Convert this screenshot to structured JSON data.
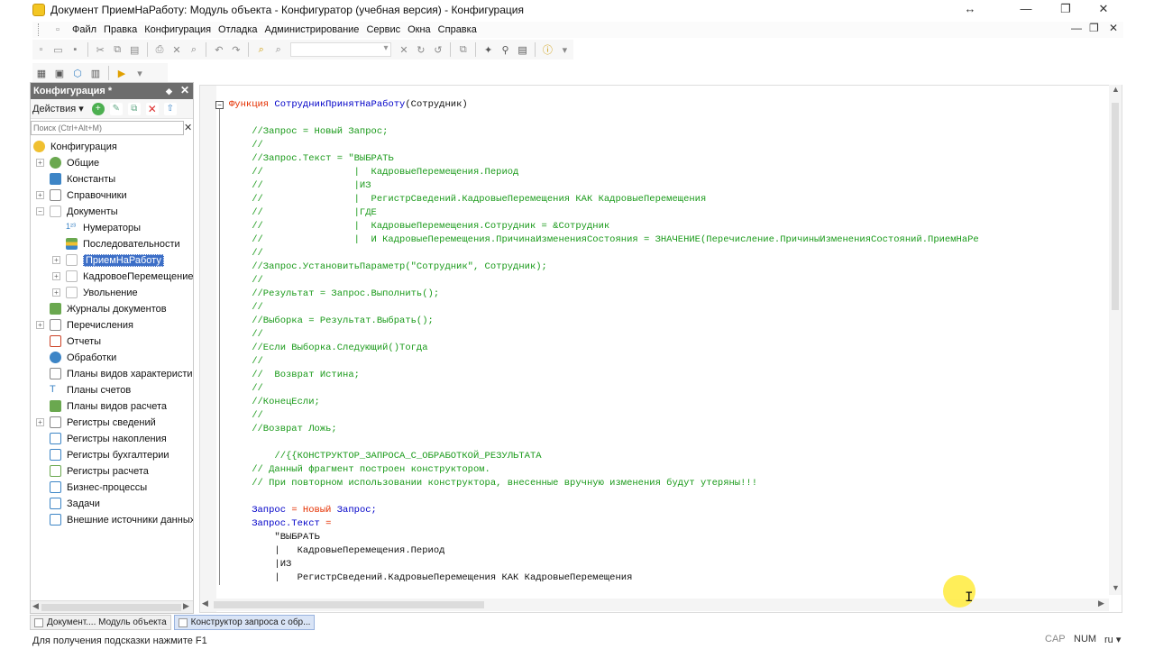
{
  "window": {
    "title": "Документ ПриемНаРаботу: Модуль объекта - Конфигуратор (учебная версия) - Конфигурация"
  },
  "menu": [
    {
      "label": "Файл"
    },
    {
      "label": "Правка"
    },
    {
      "label": "Конфигурация"
    },
    {
      "label": "Отладка"
    },
    {
      "label": "Администрирование"
    },
    {
      "label": "Сервис"
    },
    {
      "label": "Окна"
    },
    {
      "label": "Справка"
    }
  ],
  "left_panel": {
    "title": "Конфигурация *",
    "actions_label": "Действия",
    "search_placeholder": "Поиск (Ctrl+Alt+M)",
    "tree": [
      {
        "label": "Конфигурация",
        "color": "#f0c030"
      },
      {
        "label": "Общие",
        "color": "#6aa84f"
      },
      {
        "label": "Константы",
        "color": "#3d85c6"
      },
      {
        "label": "Справочники",
        "color": "#888888"
      },
      {
        "label": "Документы",
        "color": "#bbbbbb"
      },
      {
        "label": "Нумераторы",
        "color": "#3d85c6"
      },
      {
        "label": "Последовательности",
        "color": "#6aa84f"
      },
      {
        "label": "ПриемНаРаботу",
        "color": "#dddddd"
      },
      {
        "label": "КадровоеПеремещение",
        "color": "#dddddd"
      },
      {
        "label": "Увольнение",
        "color": "#dddddd"
      },
      {
        "label": "Журналы документов",
        "color": "#6aa84f"
      },
      {
        "label": "Перечисления",
        "color": "#888888"
      },
      {
        "label": "Отчеты",
        "color": "#cc4125"
      },
      {
        "label": "Обработки",
        "color": "#3d85c6"
      },
      {
        "label": "Планы видов характеристик",
        "color": "#888888"
      },
      {
        "label": "Планы счетов",
        "color": "#3d85c6"
      },
      {
        "label": "Планы видов расчета",
        "color": "#6aa84f"
      },
      {
        "label": "Регистры сведений",
        "color": "#888888"
      },
      {
        "label": "Регистры накопления",
        "color": "#3d85c6"
      },
      {
        "label": "Регистры бухгалтерии",
        "color": "#3d85c6"
      },
      {
        "label": "Регистры расчета",
        "color": "#6aa84f"
      },
      {
        "label": "Бизнес-процессы",
        "color": "#3d85c6"
      },
      {
        "label": "Задачи",
        "color": "#3d85c6"
      },
      {
        "label": "Внешние источники данных",
        "color": "#3d85c6"
      }
    ]
  },
  "code_lines": [
    [
      [
        "kw",
        "Функция "
      ],
      [
        "fn",
        "СотрудникПринятНаРаботу"
      ],
      [
        "tx",
        "(Сотрудник)"
      ]
    ],
    [],
    [
      [
        "cm",
        "    //Запрос = Новый Запрос;"
      ]
    ],
    [
      [
        "cm",
        "    //"
      ]
    ],
    [
      [
        "cm",
        "    //Запрос.Текст = \"ВЫБРАТЬ"
      ]
    ],
    [
      [
        "cm",
        "    //                |  КадровыеПеремещения.Период"
      ]
    ],
    [
      [
        "cm",
        "    //                |ИЗ"
      ]
    ],
    [
      [
        "cm",
        "    //                |  РегистрСведений.КадровыеПеремещения КАК КадровыеПеремещения"
      ]
    ],
    [
      [
        "cm",
        "    //                |ГДЕ"
      ]
    ],
    [
      [
        "cm",
        "    //                |  КадровыеПеремещения.Сотрудник = &Сотрудник"
      ]
    ],
    [
      [
        "cm",
        "    //                |  И КадровыеПеремещения.ПричинаИзмененияСостояния = ЗНАЧЕНИЕ(Перечисление.ПричиныИзмененияСостояний.ПриемНаРе"
      ]
    ],
    [
      [
        "cm",
        "    //"
      ]
    ],
    [
      [
        "cm",
        "    //Запрос.УстановитьПараметр(\"Сотрудник\", Сотрудник);"
      ]
    ],
    [
      [
        "cm",
        "    //"
      ]
    ],
    [
      [
        "cm",
        "    //Результат = Запрос.Выполнить();"
      ]
    ],
    [
      [
        "cm",
        "    //"
      ]
    ],
    [
      [
        "cm",
        "    //Выборка = Результат.Выбрать();"
      ]
    ],
    [
      [
        "cm",
        "    //"
      ]
    ],
    [
      [
        "cm",
        "    //Если Выборка.Следующий()Тогда"
      ]
    ],
    [
      [
        "cm",
        "    //"
      ]
    ],
    [
      [
        "cm",
        "    //  Возврат Истина;"
      ]
    ],
    [
      [
        "cm",
        "    //"
      ]
    ],
    [
      [
        "cm",
        "    //КонецЕсли;"
      ]
    ],
    [
      [
        "cm",
        "    //"
      ]
    ],
    [
      [
        "cm",
        "    //Возврат Ложь;"
      ]
    ],
    [],
    [
      [
        "cm",
        "        //{{КОНСТРУКТОР_ЗАПРОСА_С_ОБРАБОТКОЙ_РЕЗУЛЬТАТА"
      ]
    ],
    [
      [
        "cm",
        "    // Данный фрагмент построен конструктором."
      ]
    ],
    [
      [
        "cm",
        "    // При повторном использовании конструктора, внесенные вручную изменения будут утеряны!!!"
      ]
    ],
    [],
    [
      [
        "fn",
        "    Запрос "
      ],
      [
        "kw",
        "= Новый "
      ],
      [
        "fn",
        "Запрос;"
      ]
    ],
    [
      [
        "fn",
        "    Запрос.Текст "
      ],
      [
        "kw",
        "="
      ]
    ],
    [
      [
        "tx",
        "        \"ВЫБРАТЬ"
      ]
    ],
    [
      [
        "tx",
        "        |   КадровыеПеремещения.Период"
      ]
    ],
    [
      [
        "tx",
        "        |ИЗ"
      ]
    ],
    [
      [
        "tx",
        "        |   РегистрСведений.КадровыеПеремещения КАК КадровыеПеремещения"
      ]
    ]
  ],
  "tabs": [
    {
      "label": "Документ.... Модуль объекта"
    },
    {
      "label": "Конструктор запроса с обр..."
    }
  ],
  "status": {
    "hint": "Для получения подсказки нажмите F1",
    "cap": "CAP",
    "num": "NUM",
    "lang": "ru"
  }
}
